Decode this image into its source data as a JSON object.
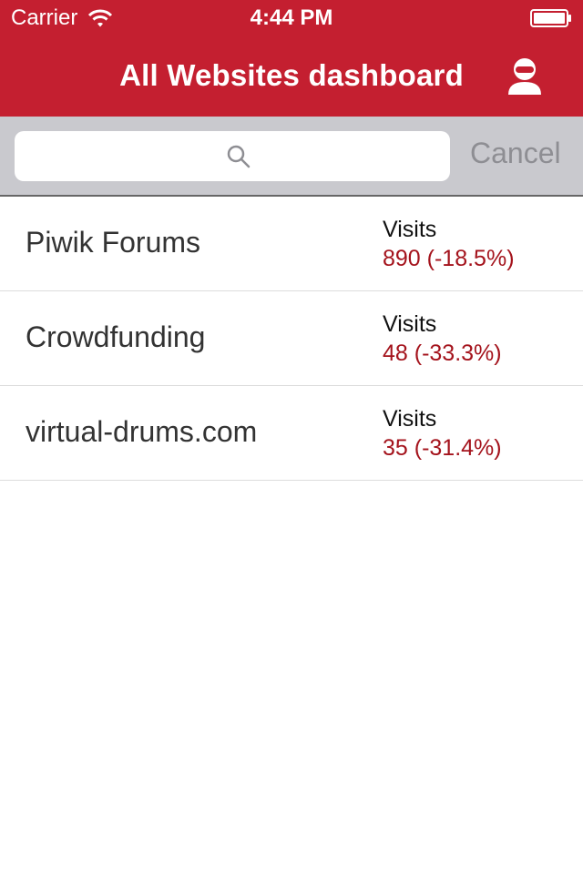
{
  "status_bar": {
    "carrier": "Carrier",
    "time": "4:44 PM",
    "icons": [
      "wifi-icon",
      "battery-icon"
    ]
  },
  "header": {
    "title": "All Websites dashboard",
    "account_icon": "account-icon",
    "background_color": "#c41f30"
  },
  "search": {
    "placeholder": "",
    "value": "",
    "cancel_label": "Cancel",
    "icon": "search-icon"
  },
  "sites": [
    {
      "name": "Piwik Forums",
      "metric_label": "Visits",
      "metric_value": "890 (-18.5%)"
    },
    {
      "name": "Crowdfunding",
      "metric_label": "Visits",
      "metric_value": "48 (-33.3%)"
    },
    {
      "name": "virtual-drums.com",
      "metric_label": "Visits",
      "metric_value": "35 (-31.4%)"
    }
  ],
  "colors": {
    "accent": "#c41f30",
    "negative_value": "#a4131c",
    "search_bar_bg": "#c9c9ce"
  }
}
